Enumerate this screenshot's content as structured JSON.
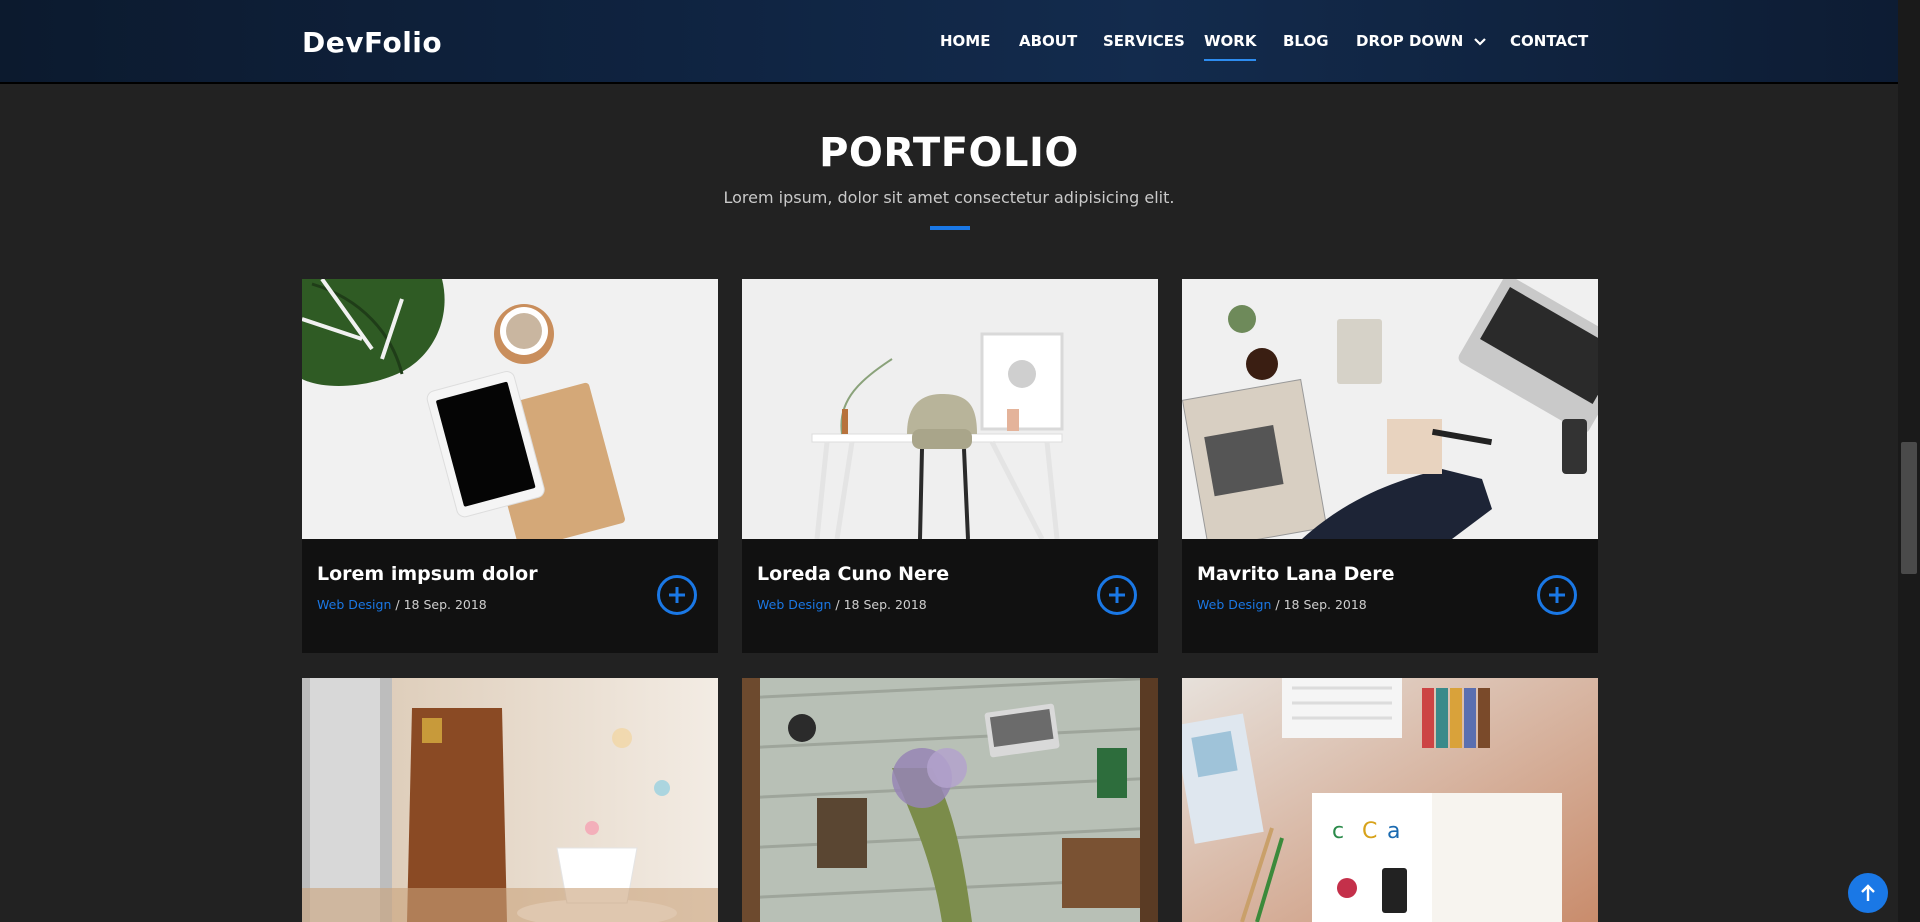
{
  "header": {
    "logo": "DevFolio",
    "nav": [
      {
        "label": "HOME"
      },
      {
        "label": "ABOUT"
      },
      {
        "label": "SERVICES"
      },
      {
        "label": "WORK",
        "active": true
      },
      {
        "label": "BLOG"
      },
      {
        "label": "DROP DOWN",
        "icon": "chevron-down-icon"
      },
      {
        "label": "CONTACT"
      }
    ]
  },
  "section": {
    "title": "PORTFOLIO",
    "subtitle": "Lorem ipsum, dolor sit amet consectetur adipisicing elit."
  },
  "cards": [
    {
      "title": "Lorem impsum dolor",
      "category": "Web Design",
      "separator": " / ",
      "date": "18 Sep. 2018",
      "icon": "plus-icon"
    },
    {
      "title": "Loreda Cuno Nere",
      "category": "Web Design",
      "separator": " / ",
      "date": "18 Sep. 2018",
      "icon": "plus-icon"
    },
    {
      "title": "Mavrito Lana Dere",
      "category": "Web Design",
      "separator": " / ",
      "date": "18 Sep. 2018",
      "icon": "plus-icon"
    },
    {
      "icon": "image"
    },
    {
      "icon": "image"
    },
    {
      "icon": "image"
    }
  ],
  "colors": {
    "accent": "#1a78e6",
    "background": "#222222",
    "card": "#111111",
    "header": "#0f2340"
  },
  "back_to_top": {
    "icon": "arrow-up-icon"
  }
}
